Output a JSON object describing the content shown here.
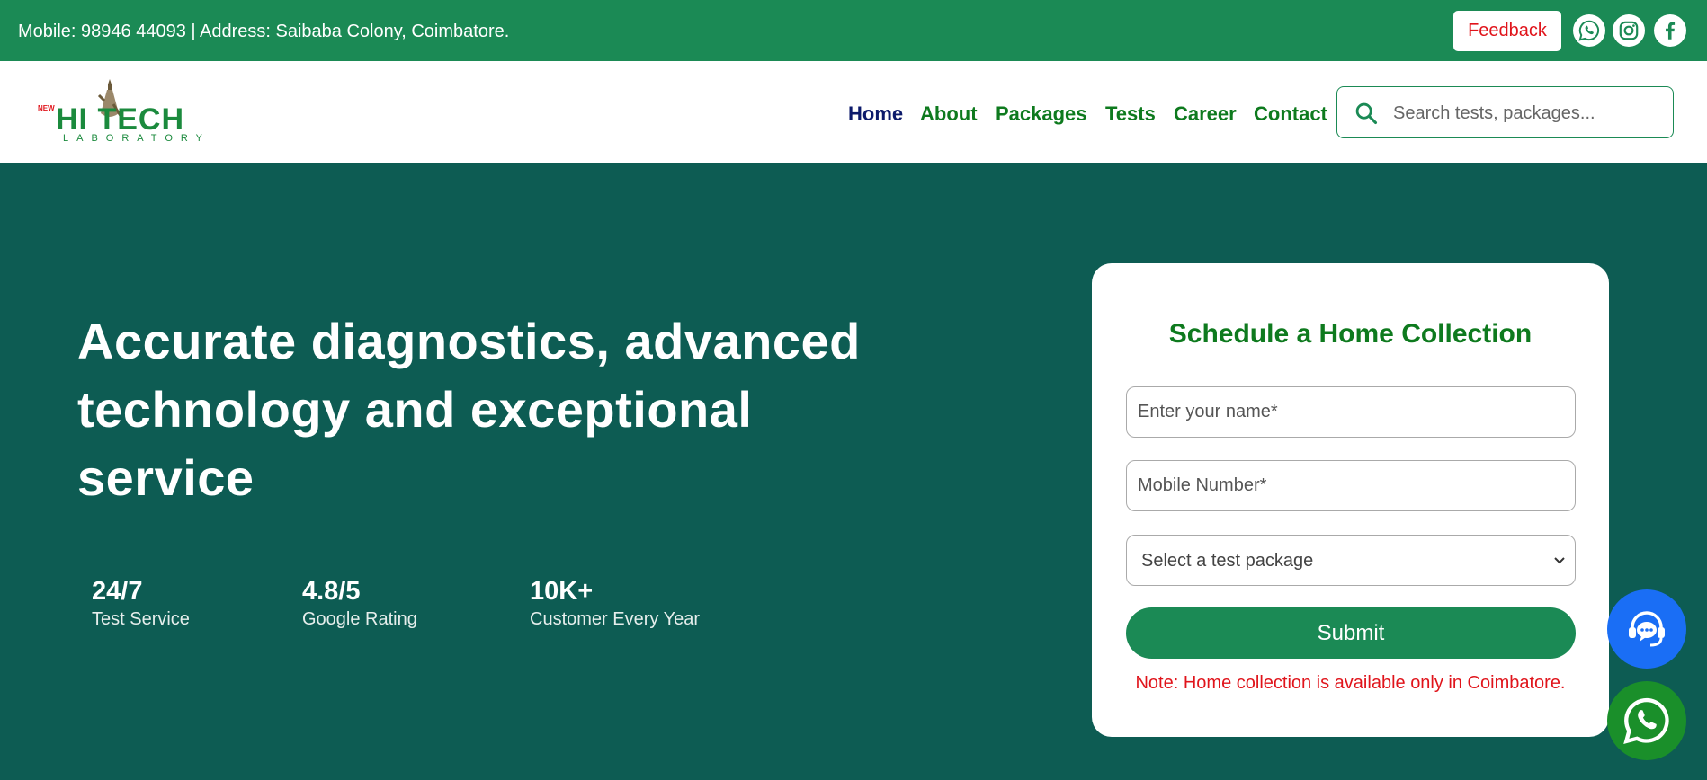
{
  "topbar": {
    "contact_text": "Mobile: 98946 44093 | Address: Saibaba Colony, Coimbatore.",
    "feedback_label": "Feedback",
    "socials": [
      "whatsapp-icon",
      "instagram-icon",
      "facebook-icon"
    ]
  },
  "header": {
    "logo": {
      "new": "NEW",
      "word": "HI TECH",
      "sub": "LABORATORY"
    },
    "nav": [
      "Home",
      "About",
      "Packages",
      "Tests",
      "Career",
      "Contact"
    ],
    "active_nav": "Home",
    "search_placeholder": "Search tests, packages..."
  },
  "hero": {
    "title": "Accurate diagnostics, advanced technology and exceptional service",
    "stats": [
      {
        "value": "24/7",
        "label": "Test Service"
      },
      {
        "value": "4.8/5",
        "label": "Google Rating"
      },
      {
        "value": "10K+",
        "label": "Customer Every Year"
      }
    ]
  },
  "form": {
    "title": "Schedule a Home Collection",
    "name_placeholder": "Enter your name*",
    "mobile_placeholder": "Mobile Number*",
    "package_selected": "Select a test package",
    "submit_label": "Submit",
    "note": "Note: Home collection is available only in Coimbatore."
  },
  "colors": {
    "brand_green": "#1b8a55",
    "hero_bg": "#0d5c53",
    "nav_green": "#0e7a1e",
    "nav_active": "#0c1a6b",
    "alert_red": "#e0141b",
    "support_blue": "#1a6ef5",
    "whatsapp_green": "#1a8f2a"
  }
}
